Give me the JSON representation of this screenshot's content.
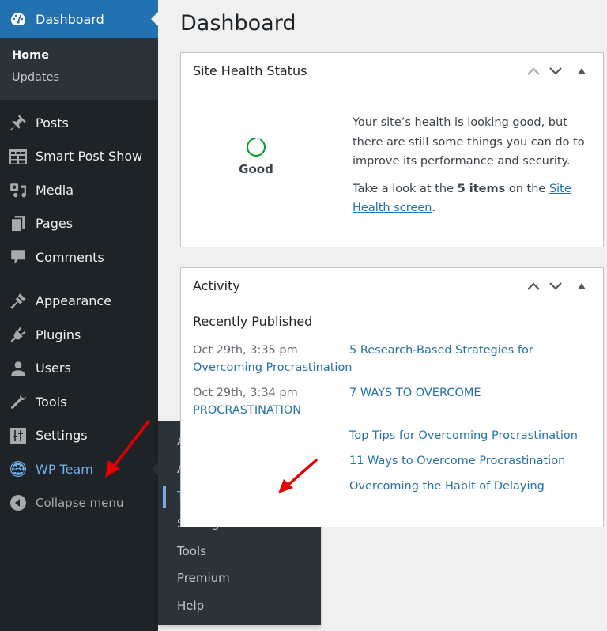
{
  "sidebar": {
    "dashboard": {
      "label": "Dashboard",
      "icon": "dashboard-icon"
    },
    "dashboard_sub": [
      {
        "label": "Home",
        "active": true
      },
      {
        "label": "Updates",
        "active": false
      }
    ],
    "items": [
      {
        "label": "Posts",
        "icon": "pin-icon"
      },
      {
        "label": "Smart Post Show",
        "icon": "grid-icon"
      },
      {
        "label": "Media",
        "icon": "media-icon"
      },
      {
        "label": "Pages",
        "icon": "pages-icon"
      },
      {
        "label": "Comments",
        "icon": "comment-icon"
      },
      {
        "label": "Appearance",
        "icon": "brush-icon"
      },
      {
        "label": "Plugins",
        "icon": "plug-icon"
      },
      {
        "label": "Users",
        "icon": "user-icon"
      },
      {
        "label": "Tools",
        "icon": "wrench-icon"
      },
      {
        "label": "Settings",
        "icon": "sliders-icon"
      },
      {
        "label": "WP Team",
        "icon": "team-icon"
      }
    ],
    "collapse_label": "Collapse menu"
  },
  "flyout": {
    "items": [
      {
        "label": "All Members",
        "active": false
      },
      {
        "label": "Add New",
        "active": false
      },
      {
        "label": "Team Generator",
        "active": true
      },
      {
        "label": "Settings",
        "active": false
      },
      {
        "label": "Tools",
        "active": false
      },
      {
        "label": "Premium",
        "active": false
      },
      {
        "label": "Help",
        "active": false
      }
    ]
  },
  "page": {
    "title": "Dashboard"
  },
  "site_health": {
    "title": "Site Health Status",
    "status_label": "Good",
    "score_fraction": 0.9,
    "status_color": "#00a32a",
    "message": "Your site’s health is looking good, but there are still some things you can do to improve its performance and security.",
    "items_prefix": "Take a look at the ",
    "items_count": "5 items",
    "items_middle": " on the ",
    "link_text": "Site Health screen",
    "items_suffix": "."
  },
  "activity": {
    "title": "Activity",
    "subtitle": "Recently Published",
    "posts": [
      {
        "date": "Oct 29th, 3:35 pm",
        "title": "5 Research-Based Strategies for Overcoming Procrastination"
      },
      {
        "date": "Oct 29th, 3:34 pm",
        "title": "7 WAYS TO OVERCOME PROCRASTINATION"
      },
      {
        "date": "",
        "title": "Top Tips for Overcoming Procrastination"
      },
      {
        "date": "",
        "title": "11 Ways to Overcome Procrastination"
      },
      {
        "date": "",
        "title": "Overcoming the Habit of Delaying"
      }
    ]
  },
  "colors": {
    "accent": "#2271b1",
    "sidebar_bg": "#1d2327",
    "submenu_bg": "#2c3338",
    "highlight": "#72aee6",
    "annotation": "#e50000"
  }
}
